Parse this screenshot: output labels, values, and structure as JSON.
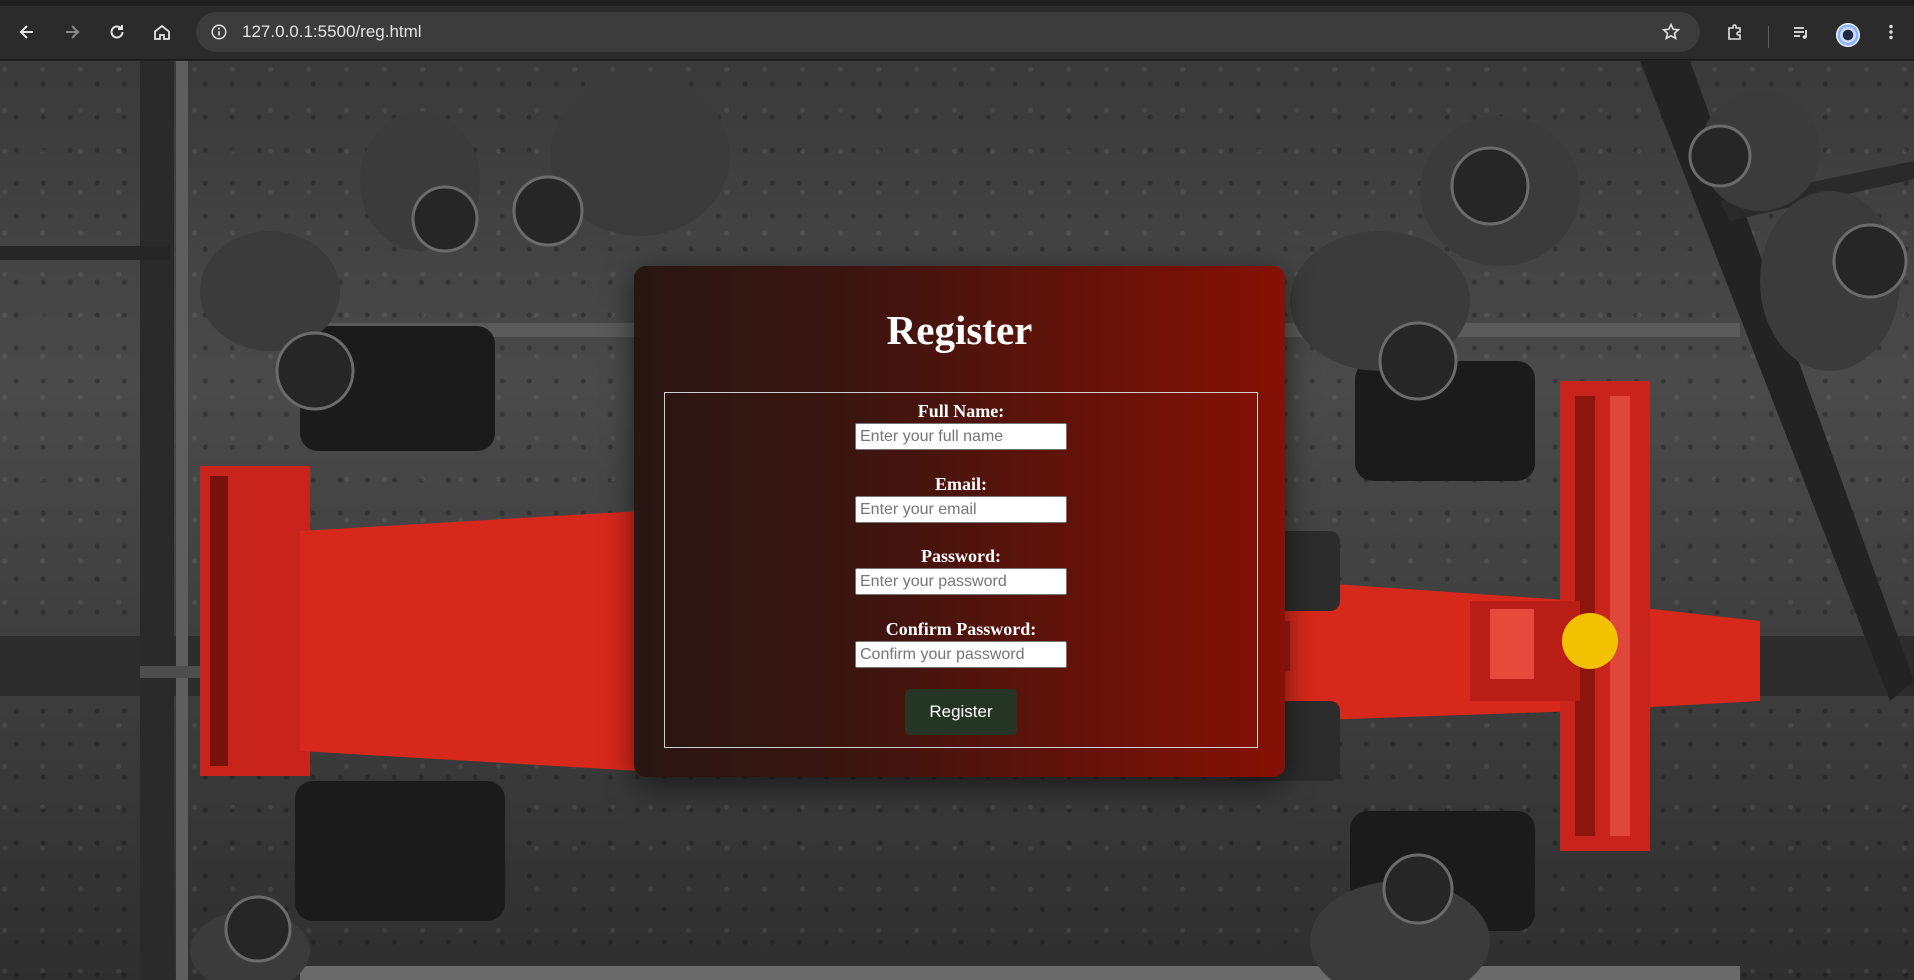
{
  "browser": {
    "url": "127.0.0.1:5500/reg.html",
    "toolbar_icons": [
      "back-icon",
      "forward-icon",
      "reload-icon",
      "home-icon",
      "site-info-icon",
      "bookmark-star-icon",
      "extensions-icon",
      "reading-list-icon",
      "profile-avatar",
      "menu-kebab-icon"
    ]
  },
  "page": {
    "background": "pit-stop-photo",
    "accent_colors": {
      "card_left": "#281613",
      "card_right": "#861106",
      "button_bg": "#253524",
      "car_red": "#d7281c"
    }
  },
  "form": {
    "title": "Register",
    "fields": [
      {
        "label": "Full Name:",
        "placeholder": "Enter your full name",
        "value": ""
      },
      {
        "label": "Email:",
        "placeholder": "Enter your email",
        "value": ""
      },
      {
        "label": "Password:",
        "placeholder": "Enter your password",
        "value": ""
      },
      {
        "label": "Confirm Password:",
        "placeholder": "Confirm your password",
        "value": ""
      }
    ],
    "submit_label": "Register"
  }
}
